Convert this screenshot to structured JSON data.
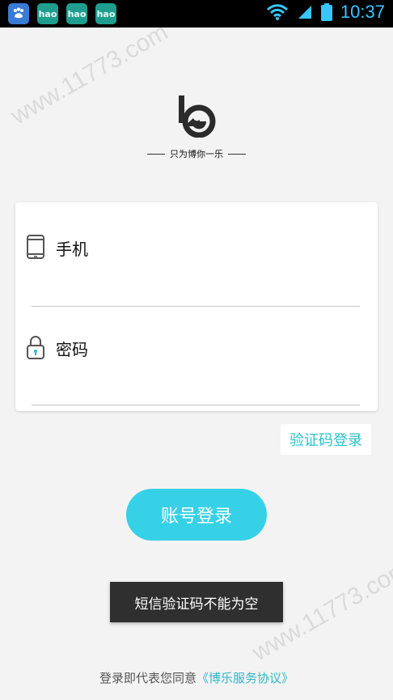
{
  "status_bar": {
    "app_icons": [
      {
        "name": "baidu-app-icon",
        "label": ""
      },
      {
        "name": "hao-app-icon",
        "label": "hao"
      },
      {
        "name": "hao-app-icon",
        "label": "hao"
      },
      {
        "name": "hao-app-icon",
        "label": "hao"
      }
    ],
    "time": "10:37",
    "time_color": "#38c6ff"
  },
  "branding": {
    "slogan": "只为博你一乐"
  },
  "form": {
    "phone_label": "手机",
    "password_label": "密码"
  },
  "sms_login_link": "验证码登录",
  "login_button": "账号登录",
  "toast": "短信验证码不能为空",
  "agreement": {
    "prefix": "登录即代表您同意",
    "link": "《博乐服务协议》"
  },
  "watermarks": [
    "www.11773.com",
    "www.11773.com"
  ],
  "colors": {
    "accent": "#36d1e6",
    "link": "#27c3cf",
    "toast_bg": "#2f2f2f"
  }
}
